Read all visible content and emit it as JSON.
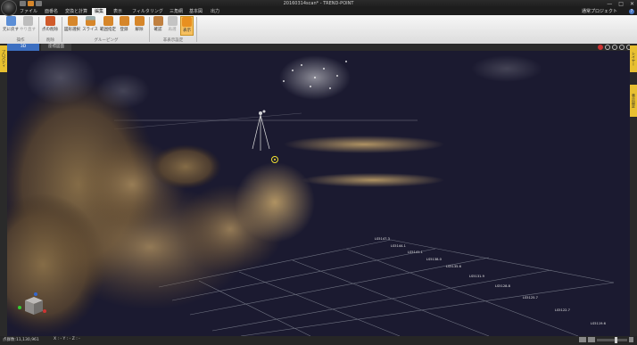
{
  "app": {
    "title": "20160314scan* - TREND-POINT",
    "window_controls": [
      "—",
      "□",
      "✕"
    ]
  },
  "menu": {
    "tabs": [
      {
        "label": "ファイル"
      },
      {
        "label": "面番名"
      },
      {
        "label": "変換と計算"
      },
      {
        "label": "編集"
      },
      {
        "label": "表示"
      },
      {
        "label": "フィルタリング"
      },
      {
        "label": "三角網"
      },
      {
        "label": "基本図"
      },
      {
        "label": "出力"
      }
    ],
    "active_tab": "編集",
    "project_label": "通常プロジェクト"
  },
  "ribbon": {
    "buttons": [
      {
        "label": "元に戻す",
        "icon": "undo-icon",
        "color": "#5b8ed6"
      },
      {
        "label": "やり直す",
        "icon": "redo-icon",
        "color": "#aaaaaa",
        "disabled": true
      },
      {
        "label": "点の削除",
        "icon": "delete-points-icon",
        "color": "#d05a2a"
      },
      {
        "label": "図形選択",
        "icon": "shape-select-icon",
        "color": "#d6862a"
      },
      {
        "label": "スライス",
        "icon": "slice-icon",
        "color": "#d6862a"
      },
      {
        "label": "範囲指定",
        "icon": "range-icon",
        "color": "#d6862a"
      },
      {
        "label": "登録",
        "icon": "register-icon",
        "color": "#d6862a"
      },
      {
        "label": "解除",
        "icon": "release-icon",
        "color": "#d6862a"
      },
      {
        "label": "確認",
        "icon": "confirm-icon",
        "color": "#c08040"
      },
      {
        "label": "再選",
        "icon": "reselect-icon",
        "color": "#aaaaaa",
        "disabled": true
      },
      {
        "label": "表示",
        "icon": "display-icon",
        "color": "#e89020",
        "selected": true
      }
    ],
    "groups": [
      "操作",
      "削除",
      "グルーピング",
      "非表示設定"
    ]
  },
  "doc_tabs": [
    "3D",
    "座標図面"
  ],
  "side_tabs": {
    "left": "プロパティ",
    "right_top": "レイヤー",
    "right_mid": "表示設定"
  },
  "viewport": {
    "point_labels": [
      "LS5147.3",
      "LS5144.1",
      "LS5141.1",
      "LS5138.0",
      "LS5135.6",
      "LS5131.9",
      "LS5128.8",
      "LS5125.7",
      "LS5122.7",
      "LS5119.6"
    ]
  },
  "status": {
    "text": "点群数:11,130,961",
    "coords": "X : - Y : - Z : -"
  },
  "colors": {
    "accent": "#d6862a",
    "viewport_bg": "#1b1a30",
    "grid": "#8a8f9c",
    "side_tab": "#e8c030"
  }
}
